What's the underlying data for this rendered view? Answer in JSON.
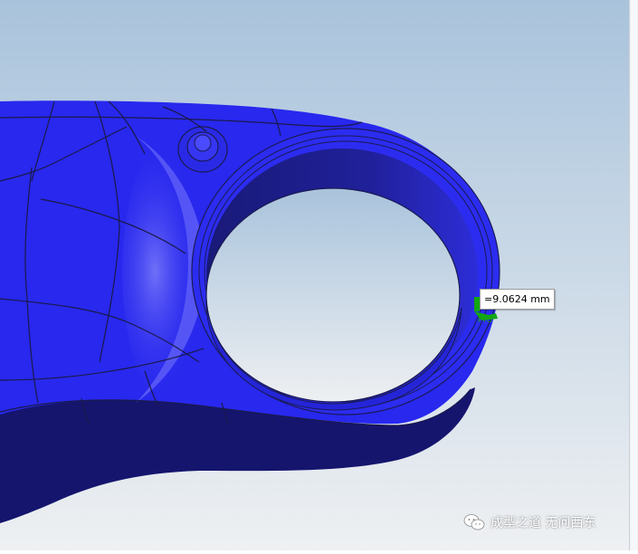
{
  "viewport": {
    "background_top": "#a9c3dc",
    "background_bottom": "#eef0f2",
    "part_color": "#2828ee",
    "part_shadow_color": "#14146a"
  },
  "measurement": {
    "value_text": "=9.0624 mm",
    "marker_color": "#12a512"
  },
  "watermark": {
    "icon": "wechat-icon",
    "text": "成型之道 无问西东"
  }
}
